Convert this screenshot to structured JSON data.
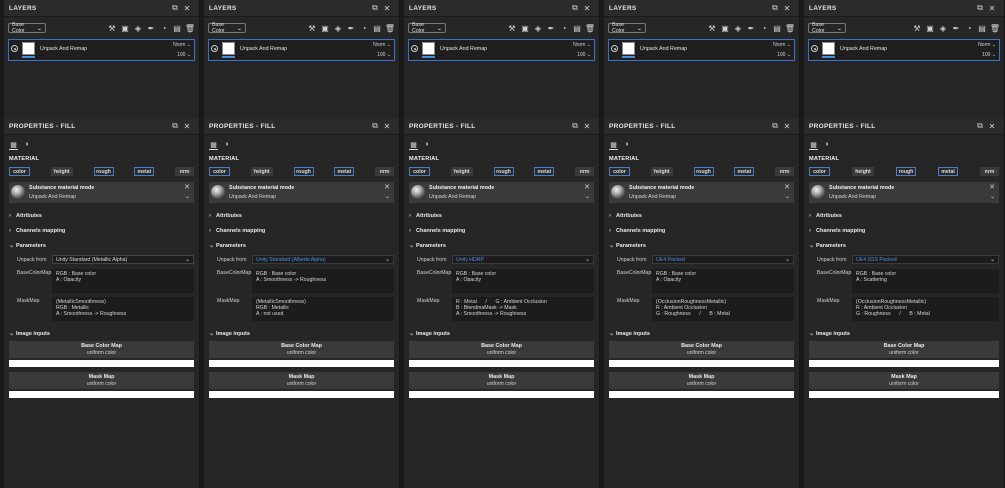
{
  "layers_panel": {
    "title": "LAYERS",
    "blend_mode": "Base Color",
    "layer": {
      "name": "Unpack And Remap",
      "blend": "Norm",
      "opacity": "100"
    }
  },
  "properties_panel": {
    "title": "PROPERTIES - FILL",
    "section_material": "MATERIAL",
    "channels": [
      "color",
      "height",
      "rough",
      "metal",
      "nrm"
    ],
    "channel_state": [
      true,
      false,
      true,
      true,
      false
    ],
    "substance_mode_title": "Substance material mode",
    "substance_mode_value": "Unpack And Remap",
    "groups": {
      "attributes": "Attributes",
      "channels_mapping": "Channels mapping",
      "parameters": "Parameters",
      "image_inputs": "Image inputs"
    },
    "unpack_from_label": "Unpack from",
    "base_color_map_label": "BaseColorMap",
    "mask_map_label": "MaskMap",
    "image_buttons": [
      {
        "title": "Base Color Map",
        "subtitle": "uniform color"
      },
      {
        "title": "Mask Map",
        "subtitle": "uniform color"
      }
    ]
  },
  "columns": [
    {
      "unpack_from": "Unity Standard (Metallic Alpha)",
      "unpack_highlight": false,
      "base_color_text": "RGB : Base color\nA : Opacity",
      "mask_text": "(MetallicSmoothness)\nRGB : Metallic\nA : Smoothness -> Roughness"
    },
    {
      "unpack_from": "Unity Standard (Albedo Alpha)",
      "unpack_highlight": true,
      "base_color_text": "RGB : Base color\nA : Smoothness -> Roughness",
      "mask_text": "(MetallicSmoothness)\nRGB : Metallic\nA : not used"
    },
    {
      "unpack_from": "Unity HDRP",
      "unpack_highlight": true,
      "base_color_text": "RGB : Base color\nA : Opacity",
      "mask_text": "R : Metal      /      G : Ambient Occlusion\nB : BlendmaMask -> Mask\nA : Smoothness -> Roughness"
    },
    {
      "unpack_from": "UE4 Packed",
      "unpack_highlight": true,
      "base_color_text": "RGB : Base color\nA : Opacity",
      "mask_text": "(OcclusionRoughnessMetallic)\nR : Ambient Occlusion\nG : Roughness      /      B : Metal"
    },
    {
      "unpack_from": "UE4 SSS Packed",
      "unpack_highlight": true,
      "base_color_text": "RGB : Base color\nA : Scattering",
      "mask_text": "(OcclusionRoughnessMetallic)\nR : Ambient Occlusion\nG : Roughness      /      B : Metal"
    }
  ]
}
